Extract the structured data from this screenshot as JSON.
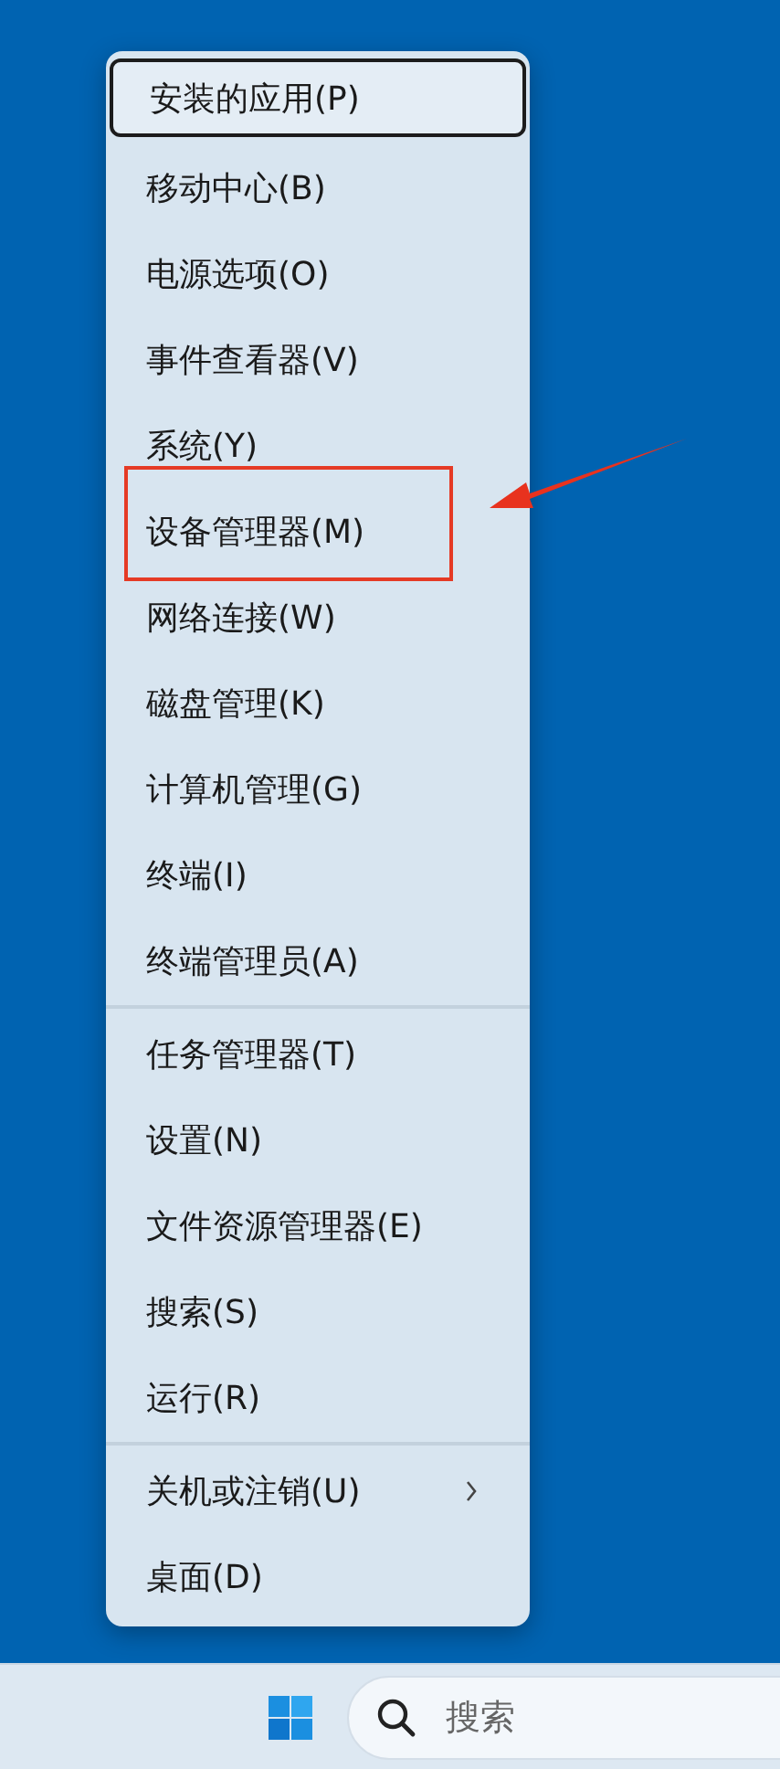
{
  "context_menu": {
    "groups": [
      {
        "items": [
          {
            "label": "安装的应用(P)",
            "selected": true,
            "submenu": false,
            "highlighted": false
          },
          {
            "label": "移动中心(B)",
            "selected": false,
            "submenu": false,
            "highlighted": false
          },
          {
            "label": "电源选项(O)",
            "selected": false,
            "submenu": false,
            "highlighted": false
          },
          {
            "label": "事件查看器(V)",
            "selected": false,
            "submenu": false,
            "highlighted": false
          },
          {
            "label": "系统(Y)",
            "selected": false,
            "submenu": false,
            "highlighted": false
          },
          {
            "label": "设备管理器(M)",
            "selected": false,
            "submenu": false,
            "highlighted": true
          },
          {
            "label": "网络连接(W)",
            "selected": false,
            "submenu": false,
            "highlighted": false
          },
          {
            "label": "磁盘管理(K)",
            "selected": false,
            "submenu": false,
            "highlighted": false
          },
          {
            "label": "计算机管理(G)",
            "selected": false,
            "submenu": false,
            "highlighted": false
          },
          {
            "label": "终端(I)",
            "selected": false,
            "submenu": false,
            "highlighted": false
          },
          {
            "label": "终端管理员(A)",
            "selected": false,
            "submenu": false,
            "highlighted": false
          }
        ]
      },
      {
        "items": [
          {
            "label": "任务管理器(T)",
            "selected": false,
            "submenu": false,
            "highlighted": false
          },
          {
            "label": "设置(N)",
            "selected": false,
            "submenu": false,
            "highlighted": false
          },
          {
            "label": "文件资源管理器(E)",
            "selected": false,
            "submenu": false,
            "highlighted": false
          },
          {
            "label": "搜索(S)",
            "selected": false,
            "submenu": false,
            "highlighted": false
          },
          {
            "label": "运行(R)",
            "selected": false,
            "submenu": false,
            "highlighted": false
          }
        ]
      },
      {
        "items": [
          {
            "label": "关机或注销(U)",
            "selected": false,
            "submenu": true,
            "highlighted": false
          },
          {
            "label": "桌面(D)",
            "selected": false,
            "submenu": false,
            "highlighted": false
          }
        ]
      }
    ]
  },
  "taskbar": {
    "search": {
      "placeholder": "搜索"
    }
  }
}
